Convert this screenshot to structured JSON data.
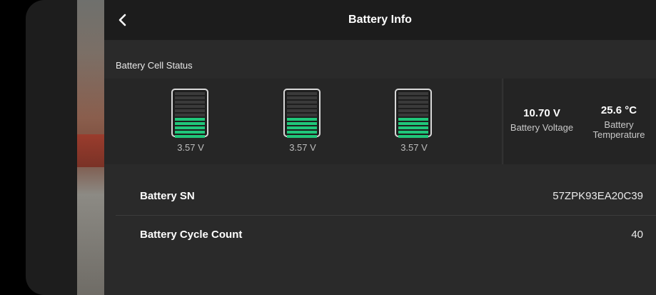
{
  "header": {
    "title": "Battery Info",
    "back_icon": "chevron-left-icon"
  },
  "cell_section": {
    "label": "Battery Cell Status",
    "cells": [
      {
        "voltage": "3.57 V",
        "bars_total": 11,
        "bars_filled": 5
      },
      {
        "voltage": "3.57 V",
        "bars_total": 11,
        "bars_filled": 5
      },
      {
        "voltage": "3.57 V",
        "bars_total": 11,
        "bars_filled": 5
      }
    ],
    "fill_color": "#20c77a"
  },
  "vitals": {
    "voltage": {
      "value": "10.70 V",
      "label": "Battery Voltage"
    },
    "temperature": {
      "value": "25.6 °C",
      "label_line1": "Battery",
      "label_line2": "Temperature"
    }
  },
  "info_rows": {
    "serial": {
      "label": "Battery SN",
      "value": "57ZPK93EA20C39"
    },
    "cycles": {
      "label": "Battery Cycle Count",
      "value": "40"
    }
  }
}
